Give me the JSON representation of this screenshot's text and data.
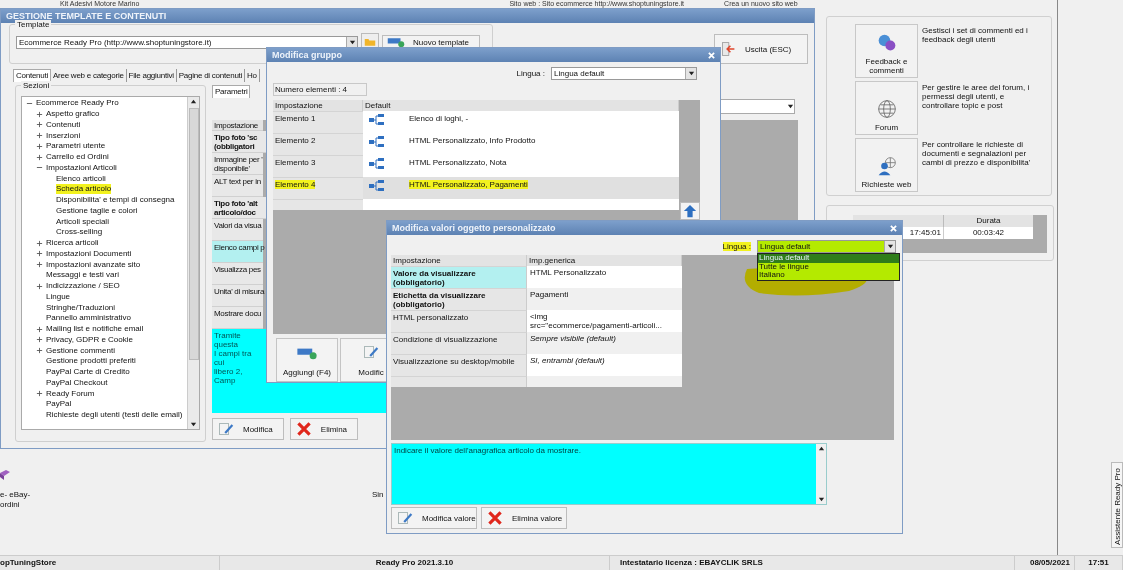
{
  "background": {
    "top_strip": [
      "Kit Adesivi Motore Marino",
      "Sito web : Sito ecommerce http://www.shoptuningstore.it",
      "Crea un nuovo sito web"
    ],
    "tools": [
      {
        "kind": "feedback",
        "label": "Feedback e commenti",
        "description": "Gestisci i set di commenti ed i feedback degli utenti"
      },
      {
        "kind": "forum",
        "label": "Forum",
        "description": "Per gestire le aree del forum, i permessi degli utenti, e controllare topic e post"
      },
      {
        "kind": "requests",
        "label": "Richieste web",
        "description": "Per controllare le richieste di documenti e segnalazioni per cambi di prezzo e disponibilita'"
      }
    ],
    "sessions": {
      "header": "Durata",
      "cells": [
        "17:45:01",
        "00:03:42"
      ]
    },
    "shortcut_label": "e- eBay- ordini",
    "partial_label": "Sin",
    "side_tab": "Assistente Ready Pro"
  },
  "main_window": {
    "title": "GESTIONE TEMPLATE E CONTENUTI",
    "template_label": "Template",
    "template_value": "Ecommerce Ready Pro (http://www.shoptuningstore.it)",
    "new_button": {
      "kind": "new",
      "label": "Nuovo template"
    },
    "exit_button": {
      "kind": "exit",
      "label": "Uscita (ESC)"
    },
    "tabs": [
      {
        "label": "Contenuti",
        "selected": true
      },
      {
        "label": "Aree web e categorie",
        "selected": false
      },
      {
        "label": "File aggiuntivi",
        "selected": false
      },
      {
        "label": "Pagine di contenuti",
        "selected": false
      },
      {
        "label": "Ho",
        "selected": false
      }
    ],
    "sections": {
      "label": "Sezioni",
      "tree": [
        {
          "label": "Ecommerce Ready Pro",
          "kind": "branch",
          "expanded": true,
          "highlighted": false,
          "children": [
            {
              "label": "Aspetto grafico",
              "kind": "branch",
              "expanded": false,
              "highlighted": false
            },
            {
              "label": "Contenuti",
              "kind": "branch",
              "expanded": false,
              "highlighted": false
            },
            {
              "label": "Inserzioni",
              "kind": "branch",
              "expanded": false,
              "highlighted": false
            },
            {
              "label": "Parametri utente",
              "kind": "branch",
              "expanded": false,
              "highlighted": false
            },
            {
              "label": "Carrello ed Ordini",
              "kind": "branch",
              "expanded": false,
              "highlighted": false
            },
            {
              "label": "Impostazioni Articoli",
              "kind": "branch",
              "expanded": true,
              "highlighted": false,
              "children": [
                {
                  "label": "Elenco articoli",
                  "kind": "leaf",
                  "highlighted": false
                },
                {
                  "label": "Scheda articolo",
                  "kind": "leaf",
                  "highlighted": true
                },
                {
                  "label": "Disponibilita' e tempi di consegna",
                  "kind": "leaf",
                  "highlighted": false
                },
                {
                  "label": "Gestione taglie e colori",
                  "kind": "leaf",
                  "highlighted": false
                },
                {
                  "label": "Articoli speciali",
                  "kind": "leaf",
                  "highlighted": false
                },
                {
                  "label": "Cross-selling",
                  "kind": "leaf",
                  "highlighted": false
                }
              ]
            },
            {
              "label": "Ricerca articoli",
              "kind": "branch",
              "expanded": false,
              "highlighted": false
            },
            {
              "label": "Impostazioni Documenti",
              "kind": "branch",
              "expanded": false,
              "highlighted": false
            },
            {
              "label": "Impostazioni avanzate sito",
              "kind": "branch",
              "expanded": false,
              "highlighted": false
            },
            {
              "label": "Messaggi e testi vari",
              "kind": "leaf",
              "highlighted": false
            },
            {
              "label": "Indicizzazione / SEO",
              "kind": "branch",
              "expanded": false,
              "highlighted": false
            },
            {
              "label": "Lingue",
              "kind": "leaf",
              "highlighted": false
            },
            {
              "label": "Stringhe/Traduzioni",
              "kind": "leaf",
              "highlighted": false
            },
            {
              "label": "Pannello amministrativo",
              "kind": "leaf",
              "highlighted": false
            },
            {
              "label": "Mailing list e notifiche email",
              "kind": "branch",
              "expanded": false,
              "highlighted": false
            },
            {
              "label": "Privacy, GDPR e Cookie",
              "kind": "branch",
              "expanded": false,
              "highlighted": false
            },
            {
              "label": "Gestione commenti",
              "kind": "branch",
              "expanded": false,
              "highlighted": false
            },
            {
              "label": "Gestione prodotti preferiti",
              "kind": "leaf",
              "highlighted": false
            },
            {
              "label": "PayPal Carte di Credito",
              "kind": "leaf",
              "highlighted": false
            },
            {
              "label": "PayPal Checkout",
              "kind": "leaf",
              "highlighted": false
            },
            {
              "label": "Ready Forum",
              "kind": "branch",
              "expanded": false,
              "highlighted": false
            },
            {
              "label": "PayPal",
              "kind": "leaf",
              "highlighted": false
            },
            {
              "label": "Richieste degli utenti (testi delle email)",
              "kind": "leaf",
              "highlighted": false
            }
          ]
        }
      ]
    },
    "params_tab": "Parametri",
    "params_rows": [
      {
        "text": "Impostazione",
        "kind": "header",
        "selected": false
      },
      {
        "text": "Tipo foto 'sc\n(obbligatori",
        "kind": "required",
        "selected": false
      },
      {
        "text": "Immagine per '\ndisponibile'",
        "kind": "optional",
        "selected": false
      },
      {
        "text": "ALT text per in",
        "kind": "optional",
        "selected": false
      },
      {
        "text": "Tipo foto 'alt\narticolo/doc",
        "kind": "required",
        "selected": false
      },
      {
        "text": "Valori da visua",
        "kind": "optional",
        "selected": false
      },
      {
        "text": "Elenco campi p",
        "kind": "optional",
        "selected": true
      },
      {
        "text": "Visualizza pes",
        "kind": "optional",
        "selected": false
      },
      {
        "text": "Unita' di misura",
        "kind": "optional",
        "selected": false
      },
      {
        "text": "Mostrare docu",
        "kind": "optional",
        "selected": false
      }
    ],
    "params_description": "Tramite questa\nI campi tra cui\nlibero 2, Camp",
    "buttons": [
      {
        "kind": "edit",
        "label": "Modifica"
      },
      {
        "kind": "delete",
        "label": "Elimina"
      }
    ]
  },
  "group_dialog": {
    "title": "Modifica gruppo",
    "language_label": "Lingua :",
    "language_value": "Lingua default",
    "count": "Numero elementi : 4",
    "columns": [
      "Impostazione",
      "Default"
    ],
    "rows": [
      {
        "name": "Elemento 1",
        "value": "Elenco di loghi, -",
        "selected": false,
        "highlighted": false
      },
      {
        "name": "Elemento 2",
        "value": "HTML Personalizzato, Info Prodotto",
        "selected": false,
        "highlighted": false
      },
      {
        "name": "Elemento 3",
        "value": "HTML Personalizzato, Nota",
        "selected": false,
        "highlighted": false
      },
      {
        "name": "Elemento 4",
        "value": "HTML Personalizzato, Pagamenti",
        "selected": true,
        "highlighted": true
      }
    ],
    "buttons": [
      {
        "kind": "add",
        "label": "Aggiungi (F4)"
      },
      {
        "kind": "edit",
        "label": "Modific"
      }
    ]
  },
  "value_dialog": {
    "title": "Modifica valori oggetto personalizzato",
    "language_label": "Lingua :",
    "language_value": "Lingua default",
    "language_highlighted": true,
    "language_options": [
      {
        "label": "Lingua default",
        "selected": true
      },
      {
        "label": "Tutte le lingue",
        "selected": false
      },
      {
        "label": "Italiano",
        "selected": false
      }
    ],
    "columns": [
      "Impostazione",
      "Imp.generica"
    ],
    "rows": [
      {
        "setting": "Valore da visualizzare (obbligatorio)",
        "value": "HTML Personalizzato",
        "required": true,
        "default": false,
        "selected": true
      },
      {
        "setting": "Etichetta da visualizzare (obbligatorio)",
        "value": "Pagamenti",
        "required": true,
        "default": false,
        "selected": false
      },
      {
        "setting": "HTML personalizzato",
        "value": "<img\nsrc=\"ecommerce/pagamenti-articoli...",
        "required": false,
        "default": false,
        "selected": false
      },
      {
        "setting": "Condizione di visualizzazione",
        "value": "Sempre visibile (default)",
        "required": false,
        "default": true,
        "selected": false
      },
      {
        "setting": "Visualizzazione su desktop/mobile",
        "value": "SI, entrambi (default)",
        "required": false,
        "default": true,
        "selected": false
      }
    ],
    "description": "Indicare il valore dell'anagrafica articolo da mostrare.",
    "buttons": [
      {
        "kind": "edit",
        "label": "Modifica valore"
      },
      {
        "kind": "delete",
        "label": "Elimina valore"
      }
    ]
  },
  "status_bar": [
    "opTuningStore",
    "Ready Pro 2021.3.10",
    "Intestatario licenza : EBAYCLIK SRLS",
    "08/05/2021",
    "17:51"
  ]
}
